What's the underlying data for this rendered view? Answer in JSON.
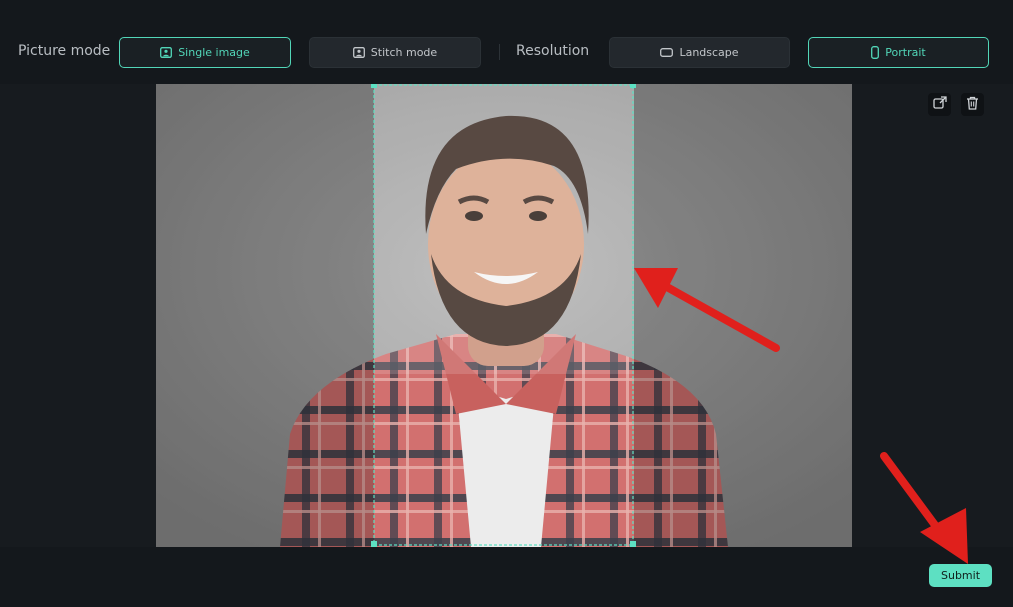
{
  "toolbar": {
    "picture_mode_label": "Picture mode",
    "single_image_label": "Single image",
    "stitch_mode_label": "Stitch mode",
    "resolution_label": "Resolution",
    "landscape_label": "Landscape",
    "portrait_label": "Portrait",
    "active_picture_mode": "Single image",
    "active_resolution": "Portrait"
  },
  "canvas": {
    "tools": [
      {
        "icon": "replace-image-icon"
      },
      {
        "icon": "trash-icon"
      }
    ]
  },
  "footer": {
    "submit_label": "Submit"
  },
  "colors": {
    "accent": "#52d6b8",
    "submit_bg": "#5de0c2",
    "background": "#14181c",
    "annotation_arrow": "#e0201c"
  }
}
